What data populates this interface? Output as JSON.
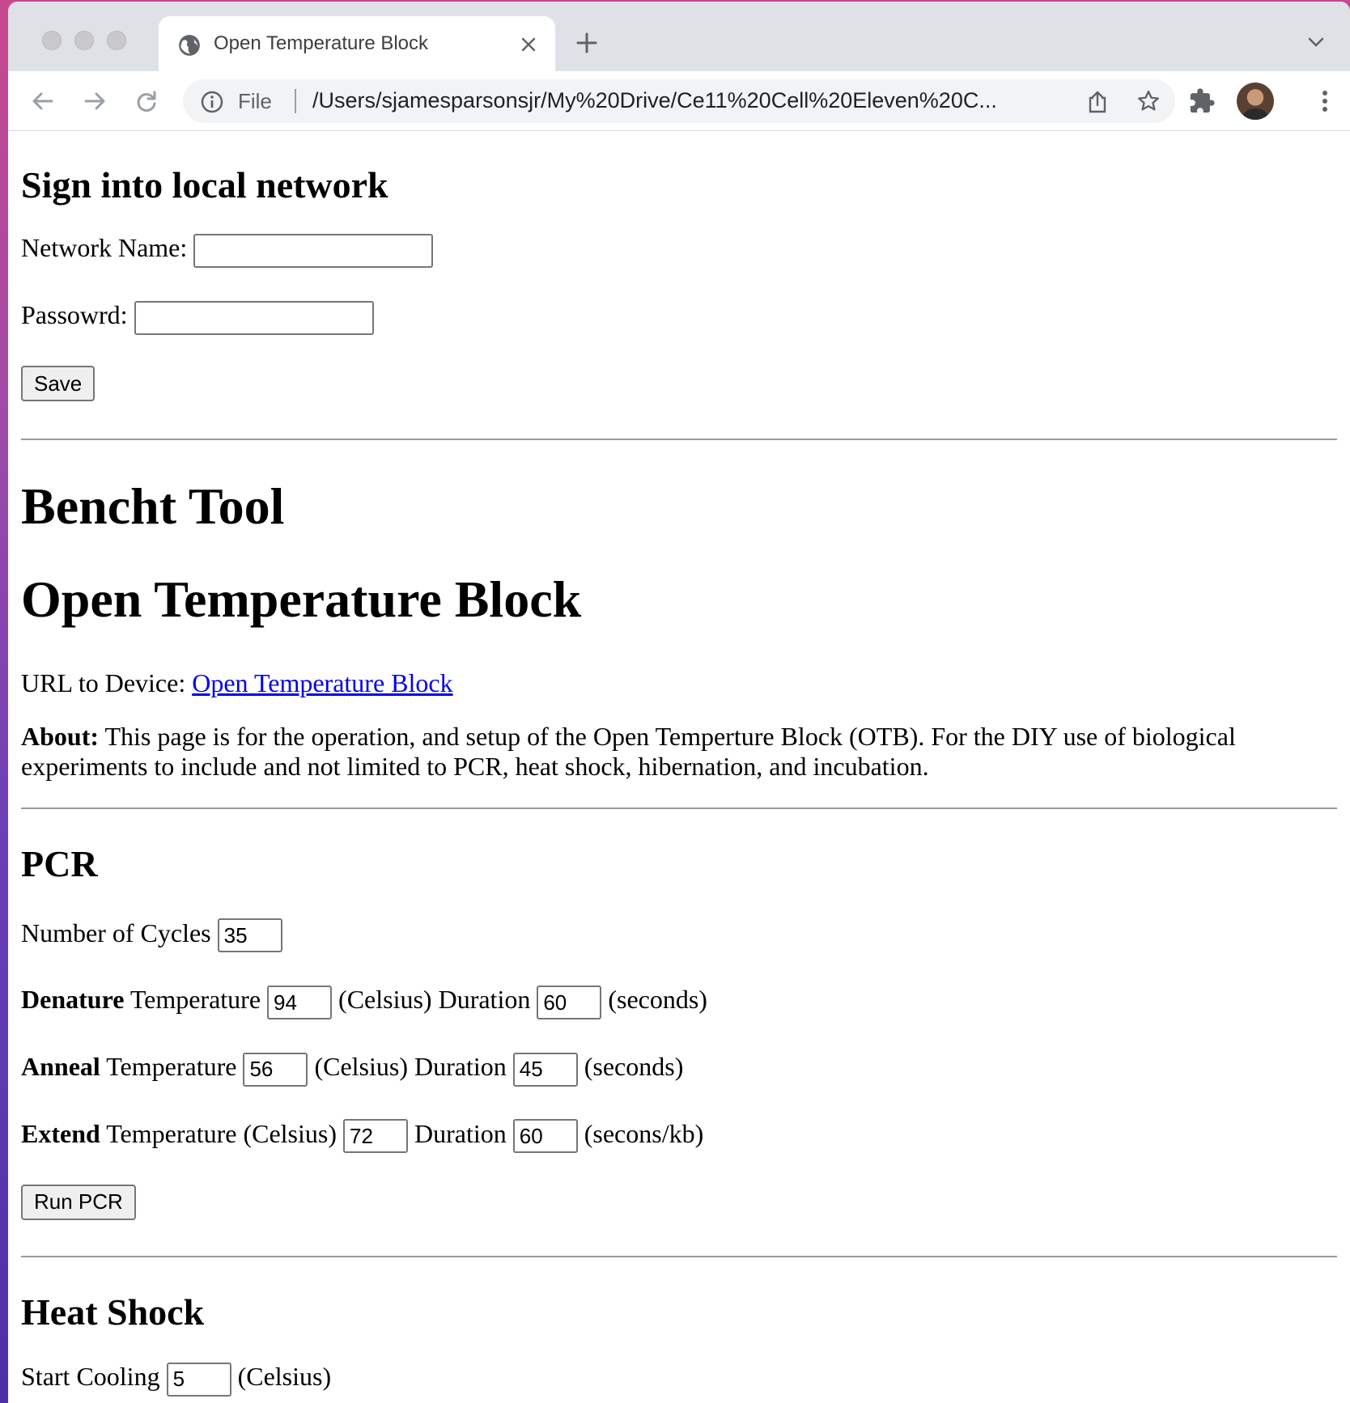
{
  "browser": {
    "tab_title": "Open Temperature Block",
    "omnibox_scheme": "File",
    "omnibox_url": "/Users/sjamesparsonsjr/My%20Drive/Ce11%20Cell%20Eleven%20C..."
  },
  "signin": {
    "heading": "Sign into local network",
    "network_label": "Network Name:",
    "network_value": "",
    "password_label": "Passowrd:",
    "password_value": "",
    "save_label": "Save"
  },
  "intro": {
    "title_1": "Bencht Tool",
    "title_2": "Open Temperature Block",
    "url_label": "URL to Device:",
    "url_link": "Open Temperature Block",
    "about_label": "About:",
    "about_text": "This page is for the operation, and setup of the Open Temperture Block (OTB). For the DIY use of biological experiments to include and not limited to PCR, heat shock, hibernation, and incubation."
  },
  "pcr": {
    "heading": "PCR",
    "cycles_label": "Number of Cycles",
    "cycles_value": "35",
    "temperature_word": "Temperature",
    "temperature_celsius_word": "Temperature (Celsius)",
    "celsius_paren": "(Celsius)",
    "duration_word": "Duration",
    "seconds_paren": "(seconds)",
    "secons_kb_paren": "(secons/kb)",
    "denature_label": "Denature",
    "denature_temp": "94",
    "denature_duration": "60",
    "anneal_label": "Anneal",
    "anneal_temp": "56",
    "anneal_duration": "45",
    "extend_label": "Extend",
    "extend_temp": "72",
    "extend_duration": "60",
    "run_label": "Run PCR"
  },
  "heatshock": {
    "heading": "Heat Shock",
    "start_cooling_label": "Start Cooling",
    "start_cooling_value": "5",
    "celsius_paren": "(Celsius)"
  },
  "colors": {
    "link": "#0000ee",
    "tabstrip_bg": "#dee1e6",
    "omnibox_bg": "#f1f3f4"
  },
  "icons": {
    "favicon": "globe-icon",
    "tab_close": "close-icon",
    "new_tab": "plus-icon",
    "tab_search": "chevron-down-icon",
    "back": "arrow-left-icon",
    "forward": "arrow-right-icon",
    "reload": "reload-icon",
    "info": "info-icon",
    "share": "share-icon",
    "bookmark": "star-icon",
    "extensions": "puzzle-icon",
    "menu": "kebab-menu-icon"
  }
}
